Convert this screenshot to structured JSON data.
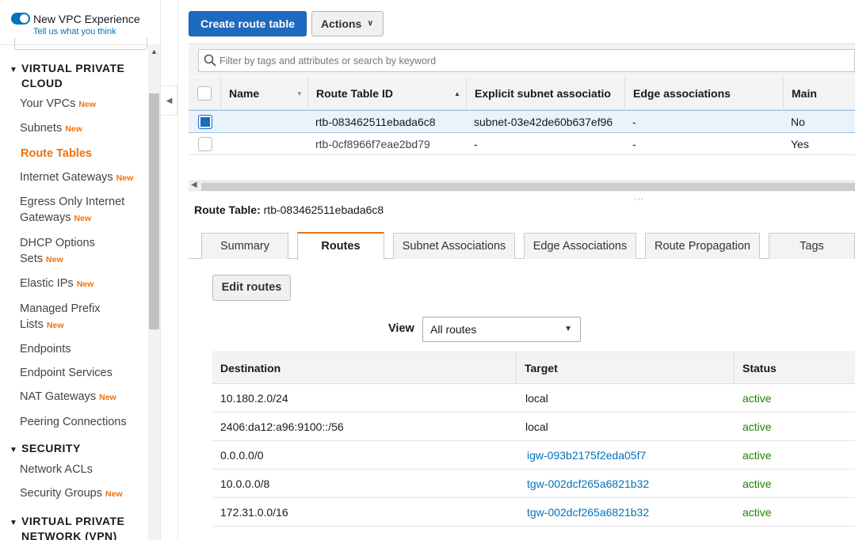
{
  "sidebar": {
    "vpc_experience": "New VPC Experience",
    "feedback_link": "Tell us what you think",
    "new_badge": "New",
    "sections": {
      "vpc": "VIRTUAL PRIVATE CLOUD",
      "security": "SECURITY",
      "vpn": "VIRTUAL PRIVATE NETWORK (VPN)"
    },
    "items": [
      {
        "label": "Your VPCs",
        "new": true
      },
      {
        "label": "Subnets",
        "new": true
      },
      {
        "label": "Route Tables",
        "new": false,
        "active": true
      },
      {
        "label": "Internet Gateways",
        "new": true
      },
      {
        "label": "Egress Only Internet Gateways",
        "new": true
      },
      {
        "label": "DHCP Options Sets",
        "new": true
      },
      {
        "label": "Elastic IPs",
        "new": true
      },
      {
        "label": "Managed Prefix Lists",
        "new": true
      },
      {
        "label": "Endpoints",
        "new": false
      },
      {
        "label": "Endpoint Services",
        "new": false
      },
      {
        "label": "NAT Gateways",
        "new": true
      },
      {
        "label": "Peering Connections",
        "new": false
      },
      {
        "label": "Network ACLs",
        "new": false
      },
      {
        "label": "Security Groups",
        "new": true
      }
    ]
  },
  "toolbar": {
    "create_label": "Create route table",
    "actions_label": "Actions"
  },
  "filter": {
    "placeholder": "Filter by tags and attributes or search by keyword"
  },
  "route_tables": {
    "columns": [
      "Name",
      "Route Table ID",
      "Explicit subnet associatio",
      "Edge associations",
      "Main"
    ],
    "rows": [
      {
        "name": "",
        "id": "rtb-083462511ebada6c8",
        "subnet": "subnet-03e42de60b637ef96",
        "edge": "-",
        "main": "No",
        "selected": true
      },
      {
        "name": "",
        "id": "rtb-0cf8966f7eae2bd79",
        "subnet": "-",
        "edge": "-",
        "main": "Yes",
        "selected": false
      }
    ]
  },
  "detail": {
    "label": "Route Table:",
    "id": "rtb-083462511ebada6c8",
    "tabs": [
      "Summary",
      "Routes",
      "Subnet Associations",
      "Edge Associations",
      "Route Propagation",
      "Tags"
    ],
    "active_tab": "Routes",
    "edit_label": "Edit routes",
    "view_label": "View",
    "view_value": "All routes"
  },
  "routes": {
    "columns": [
      "Destination",
      "Target",
      "Status"
    ],
    "rows": [
      {
        "destination": "10.180.2.0/24",
        "target": "local",
        "target_link": false,
        "status": "active"
      },
      {
        "destination": "2406:da12:a96:9100::/56",
        "target": "local",
        "target_link": false,
        "status": "active"
      },
      {
        "destination": "0.0.0.0/0",
        "target": "igw-093b2175f2eda05f7",
        "target_link": true,
        "status": "active"
      },
      {
        "destination": "10.0.0.0/8",
        "target": "tgw-002dcf265a6821b32",
        "target_link": true,
        "status": "active"
      },
      {
        "destination": "172.31.0.0/16",
        "target": "tgw-002dcf265a6821b32",
        "target_link": true,
        "status": "active"
      }
    ]
  },
  "colors": {
    "primary": "#1d6ac1",
    "accent_orange": "#ec7211",
    "link": "#0073bb",
    "status_active": "#1d8102"
  }
}
